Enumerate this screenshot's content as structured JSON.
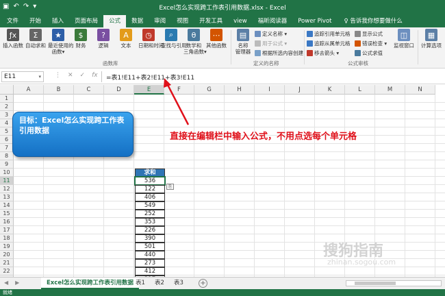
{
  "window": {
    "title": "Excel怎么实现跨工作表引用数据.xlsx - Excel",
    "qat": [
      "save-icon",
      "undo-icon",
      "redo-icon",
      "more-icon"
    ]
  },
  "tabs": [
    {
      "label": "文件",
      "active": false
    },
    {
      "label": "开始",
      "active": false
    },
    {
      "label": "插入",
      "active": false
    },
    {
      "label": "页面布局",
      "active": false
    },
    {
      "label": "公式",
      "active": true
    },
    {
      "label": "数据",
      "active": false
    },
    {
      "label": "审阅",
      "active": false
    },
    {
      "label": "视图",
      "active": false
    },
    {
      "label": "开发工具",
      "active": false
    },
    {
      "label": "view",
      "active": false
    },
    {
      "label": "福昕阅读器",
      "active": false
    },
    {
      "label": "Power Pivot",
      "active": false
    }
  ],
  "tellme": "♀ 告诉我你想要做什么",
  "ribbon": {
    "buttons": [
      {
        "label": "插入函数",
        "icon": "fx-icon",
        "color": "#555555"
      },
      {
        "label": "自动求和",
        "icon": "sigma-icon",
        "color": "#666666"
      },
      {
        "label": "最近使用的",
        "label2": "函数▾",
        "icon": "star-icon",
        "color": "#2e5fa8"
      },
      {
        "label": "财务",
        "icon": "finance-icon",
        "color": "#3b7a3b"
      },
      {
        "label": "逻辑",
        "icon": "logic-icon",
        "color": "#7a4fa1"
      },
      {
        "label": "文本",
        "icon": "text-icon",
        "color": "#e39b1a"
      },
      {
        "label": "日期和时间",
        "icon": "date-icon",
        "color": "#c0392b"
      },
      {
        "label": "查找与引用",
        "icon": "lookup-icon",
        "color": "#2a7ab0"
      },
      {
        "label": "数学和",
        "label2": "三角函数▾",
        "icon": "theta-icon",
        "color": "#4a7a9d"
      },
      {
        "label": "其他函数",
        "icon": "more-functions-icon",
        "color": "#d35400"
      }
    ],
    "group_library": "函数库",
    "names": {
      "manager": "名称",
      "manager2": "管理器",
      "define": "定义名称 ▾",
      "use": "用于公式 ▾",
      "create": "根据所选内容创建",
      "group": "定义的名称"
    },
    "audit": {
      "trace_precedents": "追踪引用单元格",
      "trace_dependents": "追踪从属单元格",
      "remove_arrows": "移去箭头 ▾",
      "show_formulas": "显示公式",
      "error_check": "错误检查 ▾",
      "evaluate": "公式求值",
      "group": "公式审核"
    },
    "watch": "监视窗口",
    "calc": "计算选项"
  },
  "formula_bar": {
    "name_box": "E11",
    "formula": "=表1!E11+表2!E11+表3!E11"
  },
  "columns": [
    "A",
    "B",
    "C",
    "D",
    "E",
    "F",
    "G",
    "H",
    "I",
    "J",
    "K",
    "L",
    "M",
    "N"
  ],
  "rows": [
    "1",
    "2",
    "3",
    "4",
    "5",
    "6",
    "7",
    "8",
    "9",
    "10",
    "11",
    "12",
    "13",
    "14",
    "15",
    "16",
    "17",
    "18",
    "19",
    "20",
    "21",
    "22",
    "23"
  ],
  "table": {
    "header": "求和",
    "values": [
      "536",
      "122",
      "406",
      "549",
      "252",
      "353",
      "226",
      "390",
      "501",
      "440",
      "273",
      "412",
      "217"
    ]
  },
  "callout": {
    "text": "目标：Excel怎么实现跨工作表引用数据"
  },
  "annotation": "直接在编辑栏中输入公式，不用点选每个单元格",
  "sheets": [
    {
      "label": "Excel怎么实现跨工作表引用数据",
      "active": true
    },
    {
      "label": "表1",
      "active": false
    },
    {
      "label": "表2",
      "active": false
    },
    {
      "label": "表3",
      "active": false
    }
  ],
  "status": "就绪",
  "watermark": "搜狗指南",
  "watermark_url": "zhinan.sogou.com"
}
